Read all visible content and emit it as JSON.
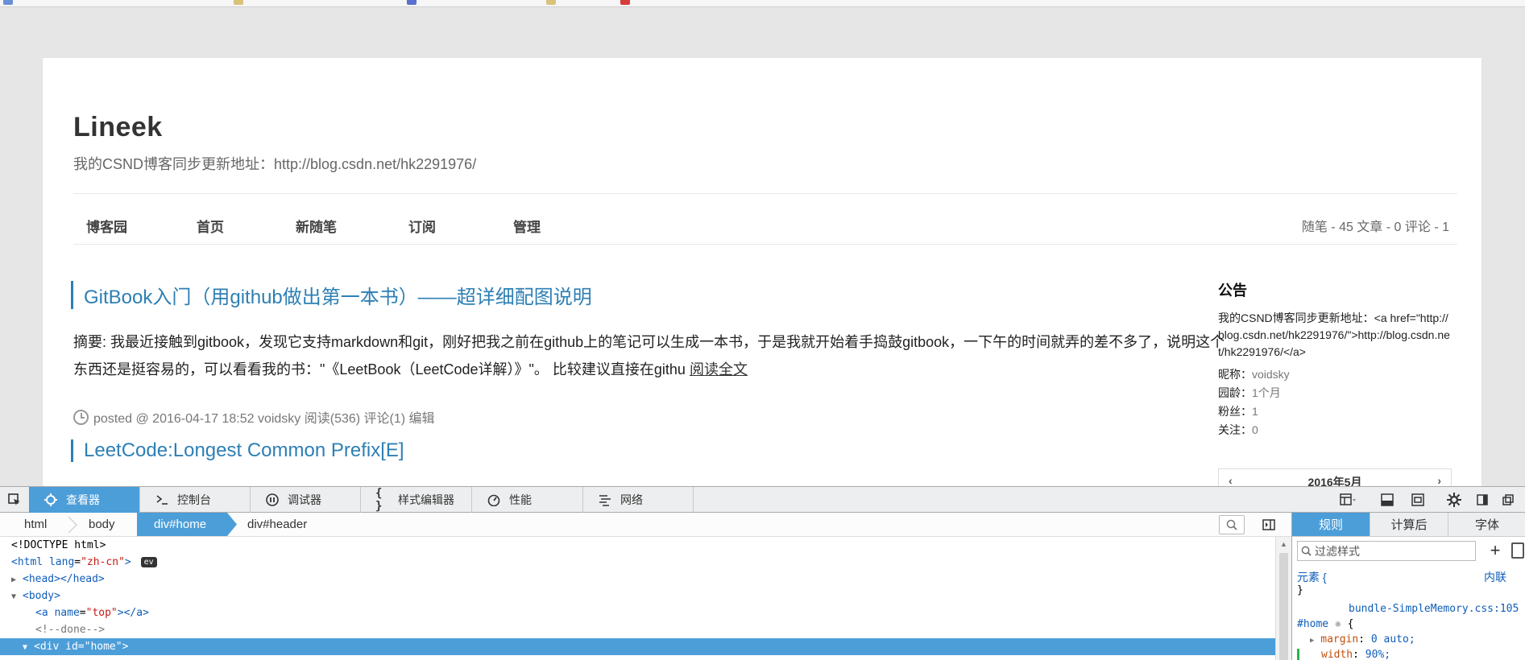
{
  "blog": {
    "title": "Lineek",
    "subtitle": "我的CSND博客同步更新地址：http://blog.csdn.net/hk2291976/"
  },
  "nav": {
    "items": [
      "博客园",
      "首页",
      "新随笔",
      "订阅",
      "管理"
    ],
    "stats": "随笔 - 45  文章 - 0  评论 - 1"
  },
  "posts": [
    {
      "title": "GitBook入门（用github做出第一本书）——超详细配图说明",
      "summary": "摘要: 我最近接触到gitbook，发现它支持markdown和git，刚好把我之前在github上的笔记可以生成一本书，于是我就开始着手捣鼓gitbook，一下午的时间就弄的差不多了，说明这个东西还是挺容易的，可以看看我的书：\"《LeetBook（LeetCode详解）》\"。 比较建议直接在githu",
      "read_more": "阅读全文",
      "meta": "posted @ 2016-04-17 18:52 voidsky 阅读(536) 评论(1) 编辑"
    },
    {
      "title": "LeetCode:Longest Common Prefix[E]"
    }
  ],
  "sidebar": {
    "heading": "公告",
    "notice": "我的CSND博客同步更新地址：<a href=\"http://blog.csdn.net/hk2291976/\">http://blog.csdn.net/hk2291976/</a>",
    "info": [
      {
        "label": "昵称：",
        "value": "voidsky"
      },
      {
        "label": "园龄：",
        "value": "1个月"
      },
      {
        "label": "粉丝：",
        "value": "1"
      },
      {
        "label": "关注：",
        "value": "0"
      }
    ],
    "calendar": {
      "prev": "‹",
      "month": "2016年5月",
      "next": "›"
    }
  },
  "devtools": {
    "tabs": [
      {
        "label": "查看器",
        "icon": "inspector-icon",
        "active": true
      },
      {
        "label": "控制台",
        "icon": "console-icon",
        "active": false
      },
      {
        "label": "调试器",
        "icon": "debugger-icon",
        "active": false
      },
      {
        "label": "样式编辑器",
        "icon": "style-editor-icon",
        "active": false
      },
      {
        "label": "性能",
        "icon": "performance-icon",
        "active": false
      },
      {
        "label": "网络",
        "icon": "network-icon",
        "active": false
      }
    ],
    "breadcrumbs": [
      "html",
      "body",
      "div#home",
      "div#header"
    ],
    "active_crumb": "div#home",
    "markup": {
      "doctype": "<!DOCTYPE html>",
      "html_open": "<html",
      "html_lang_attr": "lang",
      "html_lang_val": "\"zh-cn\"",
      "ev_badge": "ev",
      "head": "<head></head>",
      "body_open": "<body>",
      "a_open": "<a",
      "a_attr": "name",
      "a_val": "\"top\"",
      "a_close": "></a>",
      "comment": "<!--done-->",
      "div_open": "<div",
      "div_attr": "id",
      "div_val": "\"home\"",
      "tag_close": ">"
    },
    "side_tabs": [
      "规则",
      "计算后",
      "字体"
    ],
    "filter_placeholder": "过滤样式",
    "rules": {
      "element_selector": "元素 {",
      "element_close": "}",
      "inline_label": "内联",
      "source": "bundle-SimpleMemory.css:105",
      "home_selector": "#home",
      "open_brace": "{",
      "margin_prop": "margin",
      "margin_val": "0 auto;",
      "width_prop": "width",
      "width_val": "90%;"
    }
  },
  "colors": {
    "accent_blue": "#4c9ed9",
    "link_blue": "#2d7fb4",
    "page_bg": "#e6e6e6"
  }
}
